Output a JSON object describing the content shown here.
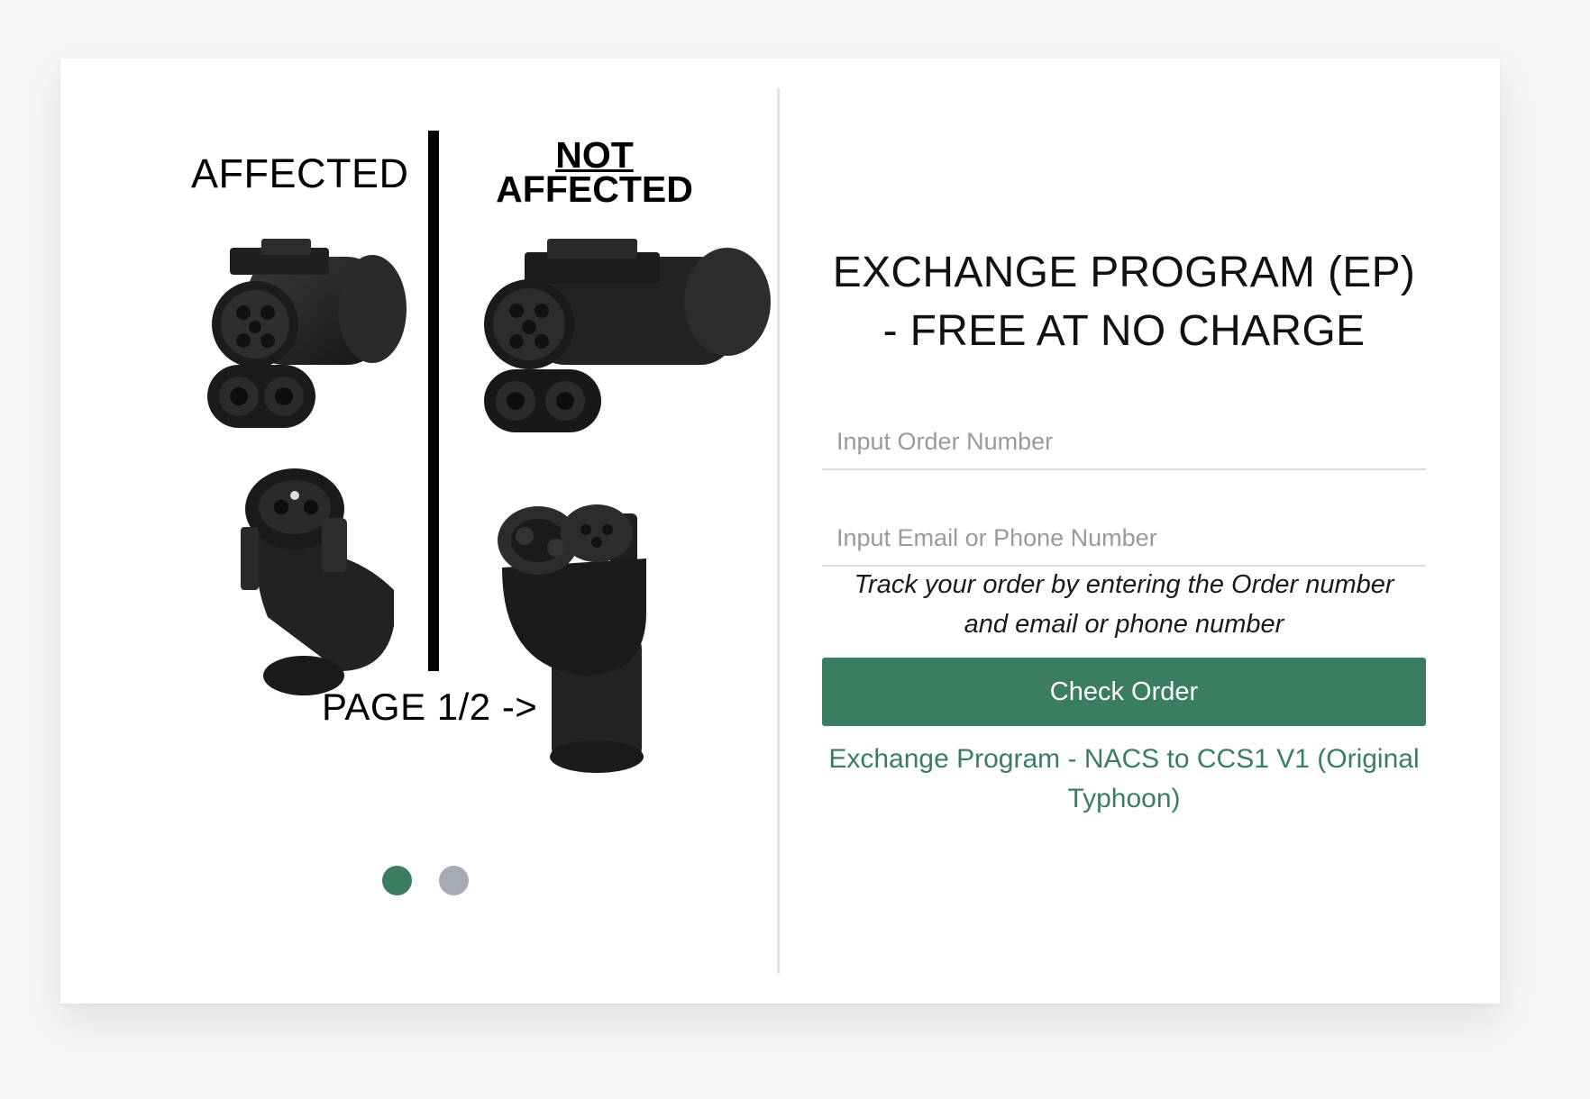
{
  "slideshow": {
    "affected_label": "AFFECTED",
    "not_label": "NOT",
    "affected_label_2": "AFFECTED",
    "page_label": "PAGE 1/2 ->",
    "dots": [
      {
        "state": "active",
        "color": "#3a7d61"
      },
      {
        "state": "inactive",
        "color": "#a7aab4"
      }
    ],
    "icons": {
      "affected_top": "nacs-adapter-icon",
      "affected_bottom": "nacs-adapter-icon",
      "not_affected_top": "ccs1-adapter-icon",
      "not_affected_bottom": "ccs1-adapter-icon"
    }
  },
  "form": {
    "title_line1": "EXCHANGE PROGRAM (EP)",
    "title_line2": "- FREE AT NO CHARGE",
    "order_placeholder": "Input Order Number",
    "contact_placeholder": "Input Email or Phone Number",
    "helper_line1": "Track your order by entering the Order number",
    "helper_line2": "and email or phone number",
    "button_label": "Check Order",
    "link_line1": "Exchange Program - NACS to CCS1 V1 (Original",
    "link_line2": "Typhoon)"
  },
  "colors": {
    "accent": "#3a7d61",
    "background": "#f5f5f7",
    "card": "#ffffff"
  }
}
